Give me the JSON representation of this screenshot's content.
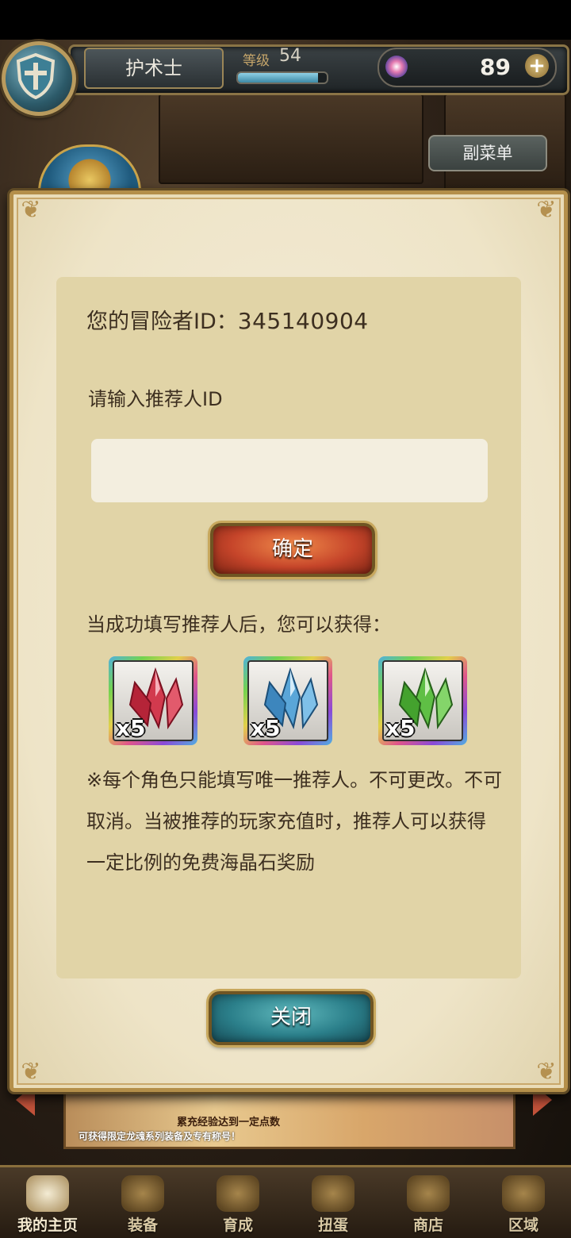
{
  "hud": {
    "job_name": "护术士",
    "level_label": "等级",
    "level_value": "54",
    "exp_progress": 0.9,
    "gem_count": "89",
    "gem_plus": "+",
    "submenu_label": "副菜单"
  },
  "dialog": {
    "adventurer_id_label": "您的冒险者ID：",
    "adventurer_id_value": "345140904",
    "referrer_prompt": "请输入推荐人ID",
    "referrer_input_value": "",
    "confirm_label": "确定",
    "reward_description": "当成功填写推荐人后，您可以获得：",
    "rewards": [
      {
        "icon": "red-crystal-icon",
        "qty": "x5",
        "color": "#d23a4e"
      },
      {
        "icon": "blue-crystal-icon",
        "qty": "x5",
        "color": "#5aa6d8"
      },
      {
        "icon": "green-crystal-icon",
        "qty": "x5",
        "color": "#5fbf45"
      }
    ],
    "notice": "※每个角色只能填写唯一推荐人。不可更改。不可取消。当被推荐的玩家充值时，推荐人可以获得一定比例的免费海晶石奖励",
    "close_label": "关闭"
  },
  "banner": {
    "line1": "累充经验达到一定点数",
    "line2": "可获得限定龙魂系列装备及专有称号！"
  },
  "nav": [
    {
      "label": "我的主页",
      "icon": "home-scroll-icon",
      "active": true
    },
    {
      "label": "装备",
      "icon": "helmet-icon",
      "active": false
    },
    {
      "label": "育成",
      "icon": "swords-icon",
      "active": false
    },
    {
      "label": "扭蛋",
      "icon": "gacha-bell-icon",
      "active": false
    },
    {
      "label": "商店",
      "icon": "shop-bag-icon",
      "active": false
    },
    {
      "label": "区域",
      "icon": "globe-icon",
      "active": false
    }
  ]
}
